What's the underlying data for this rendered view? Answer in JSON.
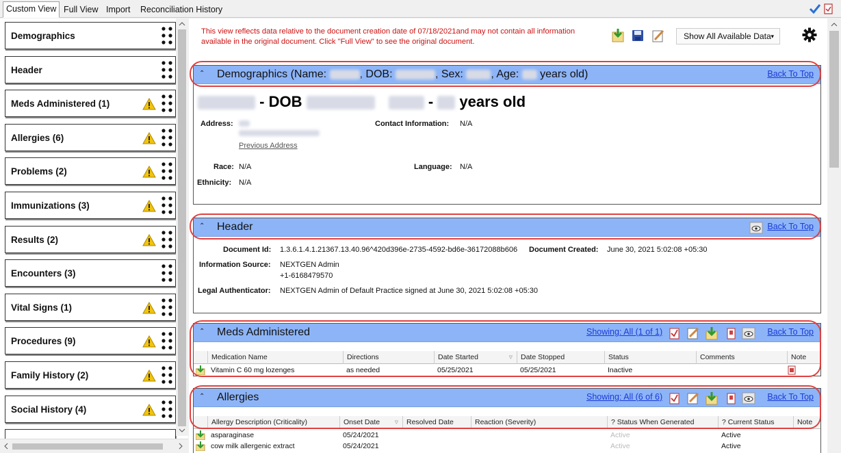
{
  "tabs": [
    "Custom View",
    "Full View",
    "Import",
    "Reconciliation History"
  ],
  "sidebar": {
    "items": [
      {
        "label": "Demographics",
        "warn": false
      },
      {
        "label": "Header",
        "warn": false
      },
      {
        "label": "Meds Administered (1)",
        "warn": true
      },
      {
        "label": "Allergies (6)",
        "warn": true
      },
      {
        "label": "Problems (2)",
        "warn": true
      },
      {
        "label": "Immunizations (3)",
        "warn": true
      },
      {
        "label": "Results (2)",
        "warn": true
      },
      {
        "label": "Encounters (3)",
        "warn": false
      },
      {
        "label": "Vital Signs (1)",
        "warn": true
      },
      {
        "label": "Procedures (9)",
        "warn": true
      },
      {
        "label": "Family History (2)",
        "warn": true
      },
      {
        "label": "Social History (4)",
        "warn": true
      }
    ]
  },
  "notice": {
    "line1_pre": "This view reflects data relative to the document creation date of ",
    "date": "07/18/2021",
    "line1_post": "and may not contain all information",
    "line2": "available in the original document. Click \"Full View\" to see the original document."
  },
  "toolbar": {
    "show_all": "Show All Available Data"
  },
  "colors": {
    "accent_header": "#8db4f7",
    "notice_red": "#cc1111",
    "link": "#1a3bd6",
    "highlight": "#e04040"
  },
  "back_to_top": "Back To Top",
  "demographics": {
    "title_pre": "Demographics (Name: ",
    "dob_lbl": ", DOB: ",
    "sex_lbl": ", Sex: ",
    "age_lbl": ", Age: ",
    "title_post": " years old)",
    "big_dob": "- DOB",
    "big_sep": "-",
    "big_years": "years old",
    "address_lbl": "Address:",
    "previous_address": "Previous Address",
    "contact_lbl": "Contact Information:",
    "contact_val": "N/A",
    "race_lbl": "Race:",
    "race_val": "N/A",
    "language_lbl": "Language:",
    "language_val": "N/A",
    "ethnicity_lbl": "Ethnicity:",
    "ethnicity_val": "N/A"
  },
  "header": {
    "title": "Header",
    "docid_lbl": "Document Id:",
    "docid_val": "1.3.6.1.4.1.21367.13.40.96^420d396e-2735-4592-bd6e-36172088b606",
    "created_lbl": "Document Created:",
    "created_val": "June 30, 2021 5:02:08 +05:30",
    "source_lbl": "Information Source:",
    "source_val1": "NEXTGEN Admin",
    "source_val2": "+1-6168479570",
    "legal_lbl": "Legal Authenticator:",
    "legal_val": "NEXTGEN Admin of Default Practice signed at June 30, 2021 5:02:08 +05:30"
  },
  "meds": {
    "title": "Meds Administered",
    "showing": "Showing: All (1 of 1)",
    "columns": [
      "Medication Name",
      "Directions",
      "Date Started",
      "Date Stopped",
      "Status",
      "Comments",
      "Note"
    ],
    "rows": [
      {
        "name": "Vitamin C 60 mg lozenges",
        "directions": "as needed",
        "started": "05/25/2021",
        "stopped": "05/25/2021",
        "status": "Inactive",
        "comments": ""
      }
    ]
  },
  "allergies": {
    "title": "Allergies",
    "showing": "Showing: All (6 of 6)",
    "columns": [
      "Allergy Description (Criticality)",
      "Onset Date",
      "Resolved Date",
      "Reaction (Severity)",
      "? Status When Generated",
      "? Current Status",
      "Note"
    ],
    "rows": [
      {
        "desc": "asparaginase",
        "onset": "05/24/2021",
        "generated": "Active",
        "current": "Active"
      },
      {
        "desc": "cow milk allergenic extract",
        "onset": "05/24/2021",
        "generated": "Active",
        "current": "Active"
      }
    ]
  }
}
